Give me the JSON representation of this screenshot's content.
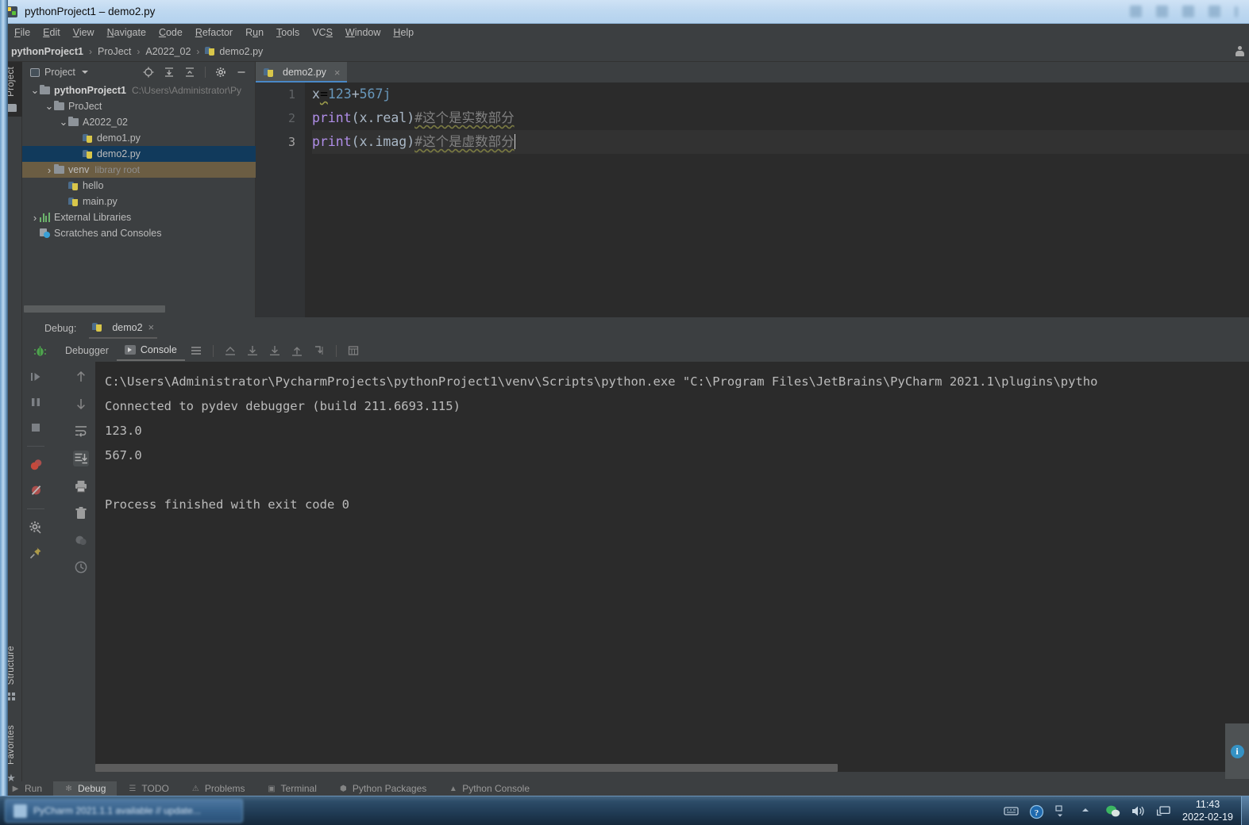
{
  "window": {
    "title": "pythonProject1 – demo2.py",
    "app_icon": "pycharm-icon"
  },
  "menubar": {
    "items": [
      {
        "label": "File",
        "mnemonic": "F"
      },
      {
        "label": "Edit",
        "mnemonic": "E"
      },
      {
        "label": "View",
        "mnemonic": "V"
      },
      {
        "label": "Navigate",
        "mnemonic": "N"
      },
      {
        "label": "Code",
        "mnemonic": "C"
      },
      {
        "label": "Refactor",
        "mnemonic": "R"
      },
      {
        "label": "Run",
        "mnemonic": "u"
      },
      {
        "label": "Tools",
        "mnemonic": "T"
      },
      {
        "label": "VCS",
        "mnemonic": "S"
      },
      {
        "label": "Window",
        "mnemonic": "W"
      },
      {
        "label": "Help",
        "mnemonic": "H"
      }
    ]
  },
  "breadcrumb": {
    "items": [
      "pythonProject1",
      "ProJect",
      "A2022_02",
      "demo2.py"
    ],
    "separator": "›"
  },
  "left_strip": {
    "project_label": "Project",
    "structure_label": "Structure",
    "favorites_label": "Favorites"
  },
  "project_panel": {
    "title": "Project",
    "tools": [
      "locate-icon",
      "expand-all-icon",
      "collapse-all-icon",
      "settings-gear-icon",
      "hide-icon"
    ],
    "tree": [
      {
        "label": "pythonProject1",
        "detail": "C:\\Users\\Administrator\\Py",
        "indent": 0,
        "arrow": "expanded",
        "icon": "folder-icon",
        "bold": true,
        "state": "none"
      },
      {
        "label": "ProJect",
        "detail": "",
        "indent": 1,
        "arrow": "expanded",
        "icon": "folder-icon",
        "bold": false,
        "state": "none"
      },
      {
        "label": "A2022_02",
        "detail": "",
        "indent": 2,
        "arrow": "expanded",
        "icon": "folder-icon",
        "bold": false,
        "state": "none"
      },
      {
        "label": "demo1.py",
        "detail": "",
        "indent": 3,
        "arrow": "none",
        "icon": "python-file-icon",
        "bold": false,
        "state": "none"
      },
      {
        "label": "demo2.py",
        "detail": "",
        "indent": 3,
        "arrow": "none",
        "icon": "python-file-icon",
        "bold": false,
        "state": "selected"
      },
      {
        "label": "venv",
        "detail": "library root",
        "indent": 1,
        "arrow": "collapsed",
        "icon": "folder-icon",
        "bold": false,
        "state": "highlighted"
      },
      {
        "label": "hello",
        "detail": "",
        "indent": 2,
        "arrow": "none",
        "icon": "python-file-icon",
        "bold": false,
        "state": "none"
      },
      {
        "label": "main.py",
        "detail": "",
        "indent": 2,
        "arrow": "none",
        "icon": "python-file-icon",
        "bold": false,
        "state": "none"
      },
      {
        "label": "External Libraries",
        "detail": "",
        "indent": 0,
        "arrow": "collapsed",
        "icon": "libraries-icon",
        "bold": false,
        "state": "none"
      },
      {
        "label": "Scratches and Consoles",
        "detail": "",
        "indent": 0,
        "arrow": "none",
        "icon": "scratches-icon",
        "bold": false,
        "state": "none"
      }
    ]
  },
  "editor": {
    "tab": {
      "label": "demo2.py",
      "icon": "python-file-icon",
      "close": "×"
    },
    "line_numbers": [
      "1",
      "2",
      "3"
    ],
    "current_line": 3,
    "code": [
      {
        "n": 1,
        "tokens": [
          {
            "t": "x",
            "c": "plain"
          },
          {
            "t": "=",
            "c": "err"
          },
          {
            "t": "123",
            "c": "num"
          },
          {
            "t": "+",
            "c": "plain"
          },
          {
            "t": "567j",
            "c": "num"
          }
        ]
      },
      {
        "n": 2,
        "tokens": [
          {
            "t": "print",
            "c": "fn"
          },
          {
            "t": "(x.real)",
            "c": "plain"
          },
          {
            "t": "#这个是实数部分",
            "c": "comment"
          }
        ]
      },
      {
        "n": 3,
        "tokens": [
          {
            "t": "print",
            "c": "fn"
          },
          {
            "t": "(x.imag)",
            "c": "plain"
          },
          {
            "t": "#这个是虚数部分",
            "c": "comment"
          }
        ]
      }
    ]
  },
  "debug": {
    "header_label": "Debug:",
    "run_config": "demo2",
    "run_config_close": "×",
    "bug_icon": "debug-bug-icon",
    "tabs": [
      {
        "label": "Debugger",
        "active": false,
        "icon": null
      },
      {
        "label": "Console",
        "active": true,
        "icon": "console-icon"
      }
    ],
    "toolbar_icons": [
      "align-list-icon",
      "soft-wrap-icon",
      "scroll-to-end-icon",
      "download-icon",
      "upload-icon",
      "jump-to-end-icon",
      "table-view-icon"
    ],
    "left_actions": [
      "resume-program-icon",
      "pause-program-icon",
      "stop-icon",
      "view-breakpoints-icon",
      "mute-breakpoints-icon",
      "settings-gear-icon",
      "pin-tab-icon"
    ],
    "left_actions2": [
      "up-arrow-icon",
      "down-arrow-icon",
      "soft-wrap-icon",
      "scroll-to-end-icon",
      "print-icon",
      "trash-icon",
      "clear-all-icon",
      "history-icon"
    ],
    "console_lines": [
      "C:\\Users\\Administrator\\PycharmProjects\\pythonProject1\\venv\\Scripts\\python.exe \"C:\\Program Files\\JetBrains\\PyCharm 2021.1\\plugins\\pytho",
      "Connected to pydev debugger (build 211.6693.115)",
      "123.0",
      "567.0",
      "",
      "Process finished with exit code 0"
    ],
    "notification_icon": "info-icon"
  },
  "bottom_tabs": [
    {
      "label": "Run",
      "icon": "run-icon",
      "active": false
    },
    {
      "label": "Debug",
      "icon": "debug-icon",
      "active": true
    },
    {
      "label": "TODO",
      "icon": "todo-icon",
      "active": false
    },
    {
      "label": "Problems",
      "icon": "problems-icon",
      "active": false
    },
    {
      "label": "Terminal",
      "icon": "terminal-icon",
      "active": false
    },
    {
      "label": "Python Packages",
      "icon": "packages-icon",
      "active": false
    },
    {
      "label": "Python Console",
      "icon": "python-console-icon",
      "active": false
    }
  ],
  "taskbar": {
    "button_label": "PyCharm 2021.1.1 available // update...",
    "tray_icons": [
      "keyboard-icon",
      "help-icon",
      "show-hidden-icon",
      "up-arrow-icon",
      "wechat-icon",
      "volume-icon",
      "network-icon"
    ],
    "time": "11:43",
    "date": "2022-02-19"
  },
  "colors": {
    "accent_blue": "#4a88c7",
    "selection_blue": "#113a5c",
    "editor_bg": "#2b2b2b",
    "panel_bg": "#3c3f41",
    "text": "#bbbbbb",
    "comment": "#808080",
    "number": "#6897bb",
    "function": "#b08ee8"
  }
}
